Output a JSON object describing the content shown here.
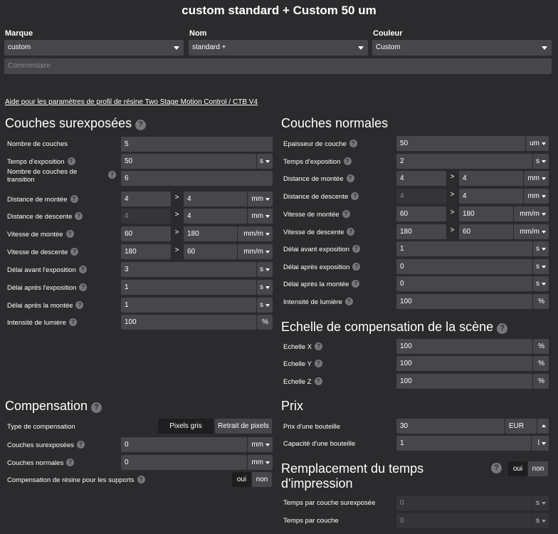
{
  "header": {
    "title": "custom standard + Custom 50 um"
  },
  "selectors": {
    "marque": {
      "label": "Marque",
      "value": "custom"
    },
    "nom": {
      "label": "Nom",
      "value": "standard +"
    },
    "couleur": {
      "label": "Couleur",
      "value": "Custom"
    },
    "comment_placeholder": "Commentaire"
  },
  "help_link": "Aide pour les paramètres de profil de résine Two Stage Motion Control / CTB V4",
  "overexposed": {
    "title": "Couches surexposées",
    "rows": [
      {
        "label": "Nombre de couches",
        "value": "5"
      },
      {
        "label": "Temps d'exposition",
        "value": "50",
        "unit": "s"
      },
      {
        "label": "Nombre de couches de transition",
        "value": "6"
      },
      {
        "label": "Distance de montée",
        "v1": "4",
        "v2": "4",
        "unit": "mm"
      },
      {
        "label": "Distance de descente",
        "v1": "4",
        "v2": "4",
        "unit": "mm"
      },
      {
        "label": "Vitesse de montée",
        "v1": "60",
        "v2": "180",
        "unit": "mm/m"
      },
      {
        "label": "Vitesse de descente",
        "v1": "180",
        "v2": "60",
        "unit": "mm/m"
      },
      {
        "label": "Délai avant l'exposition",
        "value": "3",
        "unit": "s"
      },
      {
        "label": "Délai après l'exposition",
        "value": "1",
        "unit": "s"
      },
      {
        "label": "Délai après la montée",
        "value": "1",
        "unit": "s"
      },
      {
        "label": "Intensité de lumière",
        "value": "100",
        "unit": "%"
      }
    ]
  },
  "normal": {
    "title": "Couches normales",
    "rows": [
      {
        "label": "Epaisseur de couche",
        "value": "50",
        "unit": "um"
      },
      {
        "label": "Temps d'exposition",
        "value": "2",
        "unit": "s"
      },
      {
        "label": "Distance de montée",
        "v1": "4",
        "v2": "4",
        "unit": "mm"
      },
      {
        "label": "Distance de descente",
        "v1": "4",
        "v2": "4",
        "unit": "mm"
      },
      {
        "label": "Vitesse de montée",
        "v1": "60",
        "v2": "180",
        "unit": "mm/m"
      },
      {
        "label": "Vitesse de descente",
        "v1": "180",
        "v2": "60",
        "unit": "mm/m"
      },
      {
        "label": "Délai avant exposition",
        "value": "1",
        "unit": "s"
      },
      {
        "label": "Délai après exposition",
        "value": "0",
        "unit": "s"
      },
      {
        "label": "Délai après la montée",
        "value": "0",
        "unit": "s"
      },
      {
        "label": "Intensité de lumière",
        "value": "100",
        "unit": "%"
      }
    ]
  },
  "scale": {
    "title": "Echelle de compensation de la scène",
    "rows": [
      {
        "label": "Echelle X",
        "value": "100",
        "unit": "%"
      },
      {
        "label": "Echelle Y",
        "value": "100",
        "unit": "%"
      },
      {
        "label": "Echelle Z",
        "value": "100",
        "unit": "%"
      }
    ]
  },
  "compensation": {
    "title": "Compensation",
    "type_label": "Type de compensation",
    "type_options": [
      "Pixels gris",
      "Retrait de pixels"
    ],
    "rows": [
      {
        "label": "Couches surexposées",
        "value": "0",
        "unit": "mm"
      },
      {
        "label": "Couches normales",
        "value": "0",
        "unit": "mm"
      }
    ],
    "support_label": "Compensation de résine pour les supports",
    "yes": "oui",
    "no": "non"
  },
  "prix": {
    "title": "Prix",
    "bottle_price_label": "Prix d'une bouteille",
    "bottle_price": "30",
    "currency": "EUR",
    "bottle_capacity_label": "Capacité d'une bouteille",
    "bottle_capacity": "1",
    "capacity_unit": "l"
  },
  "replacement": {
    "title_line1": "Remplacement du temps",
    "title_line2": "d'impression",
    "yes": "oui",
    "no": "non",
    "rows": [
      {
        "label": "Temps par couche surexposée",
        "value": "0",
        "unit": "s"
      },
      {
        "label": "Temps par couche",
        "value": "0",
        "unit": "s"
      }
    ]
  }
}
